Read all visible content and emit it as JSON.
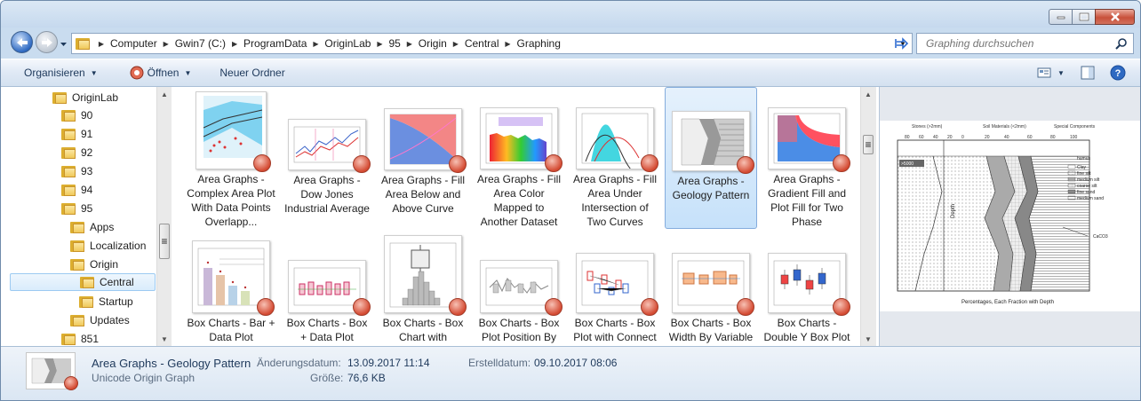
{
  "window": {
    "controls": {
      "minimize_icon": "minimize-icon",
      "maximize_icon": "maximize-icon",
      "close_icon": "close-icon"
    }
  },
  "address": {
    "crumbs": [
      "Computer",
      "Gwin7 (C:)",
      "ProgramData",
      "OriginLab",
      "95",
      "Origin",
      "Central",
      "Graphing"
    ],
    "search_placeholder": "Graphing durchsuchen"
  },
  "toolbar": {
    "organize": "Organisieren",
    "open": "Öffnen",
    "new_folder": "Neuer Ordner"
  },
  "tree": {
    "items": [
      "OriginLab",
      "90",
      "91",
      "92",
      "93",
      "94",
      "95",
      "Apps",
      "Localization",
      "Origin",
      "Central",
      "Startup",
      "Updates",
      "851"
    ],
    "selected": "Central"
  },
  "files": [
    {
      "caption": "Area Graphs - Complex Area Plot With Data Points Overlapp...",
      "thumb": "complex-area"
    },
    {
      "caption": "Area Graphs - Dow Jones Industrial Average",
      "thumb": "dow-jones"
    },
    {
      "caption": "Area Graphs - Fill Area Below and Above Curve",
      "thumb": "fill-below-above"
    },
    {
      "caption": "Area Graphs - Fill Area Color Mapped to Another Dataset",
      "thumb": "color-mapped"
    },
    {
      "caption": "Area Graphs - Fill Area Under Intersection of Two Curves",
      "thumb": "intersection"
    },
    {
      "caption": "Area Graphs - Geology Pattern",
      "thumb": "geology"
    },
    {
      "caption": "Area Graphs - Gradient Fill and Plot Fill for Two Phase",
      "thumb": "gradient"
    },
    {
      "caption": "Box Charts - Bar + Data Plot",
      "thumb": "bar-data"
    },
    {
      "caption": "Box Charts - Box + Data Plot",
      "thumb": "box-data"
    },
    {
      "caption": "Box Charts - Box Chart with Histogram",
      "thumb": "box-hist"
    },
    {
      "caption": "Box Charts - Box Plot Position By Variable",
      "thumb": "box-position"
    },
    {
      "caption": "Box Charts - Box Plot with Connect Lines",
      "thumb": "box-connect"
    },
    {
      "caption": "Box Charts - Box Width By Variable",
      "thumb": "box-width"
    },
    {
      "caption": "Box Charts - Double Y Box Plot",
      "thumb": "double-y"
    }
  ],
  "preview": {
    "axis_left": "Depth",
    "axis_bottom": "Percentages, Each Fraction with Depth",
    "legend": [
      "humus",
      "Clay",
      "fine silt",
      "medium silt",
      "coarse silt",
      "fine sand",
      "medium sand"
    ],
    "annotation": "CaCO3",
    "top_labels": [
      "Stones (>2mm)",
      "Soil Materials (<2mm)",
      "Special Components"
    ]
  },
  "details": {
    "name": "Area Graphs - Geology Pattern",
    "type": "Unicode Origin Graph",
    "modified_label": "Änderungsdatum:",
    "modified_value": "13.09.2017 11:14",
    "created_label": "Erstelldatum:",
    "created_value": "09.10.2017 08:06",
    "size_label": "Größe:",
    "size_value": "76,6 KB"
  }
}
